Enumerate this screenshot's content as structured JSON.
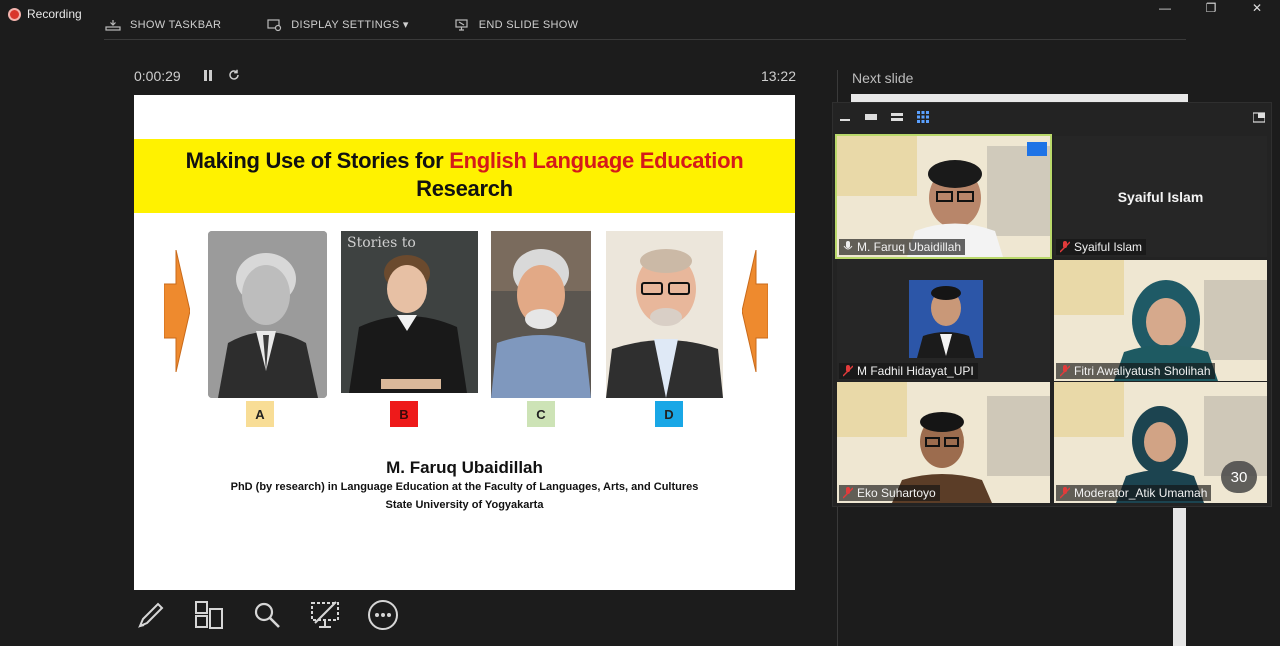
{
  "recording": {
    "label": "Recording"
  },
  "toolbar": {
    "show_taskbar": "SHOW TASKBAR",
    "display_settings": "DISPLAY SETTINGS ▾",
    "end_slide_show": "END SLIDE SHOW"
  },
  "timer": {
    "elapsed": "0:00:29",
    "clock": "13:22"
  },
  "slide": {
    "title_part1": "Making Use of Stories for ",
    "title_part2": "English Language Education",
    "title_line2": "Research",
    "chalk_text": "Stories to",
    "labels": [
      "A",
      "B",
      "C",
      "D"
    ],
    "label_colors": [
      "#f8dd96",
      "#ee1a1a",
      "#cde3b6",
      "#19a7e6"
    ],
    "presenter_name": "M. Faruq Ubaidillah",
    "presenter_line1": "PhD (by research) in Language Education at the Faculty of Languages, Arts, and Cultures",
    "presenter_line2": "State University of Yogyakarta"
  },
  "tools": [
    "pen-icon",
    "see-all-slides-icon",
    "zoom-icon",
    "black-screen-icon",
    "more-options-icon"
  ],
  "next_slide": {
    "label": "Next slide"
  },
  "call": {
    "participants": [
      {
        "name": "M. Faruq Ubaidillah",
        "muted": false,
        "video": true
      },
      {
        "name": "Syaiful Islam",
        "muted": true,
        "video": false,
        "display_name": "Syaiful Islam"
      },
      {
        "name": "M Fadhil Hidayat_UPI",
        "muted": true,
        "video": true
      },
      {
        "name": "Fitri Awaliyatush Sholihah",
        "muted": true,
        "video": true
      },
      {
        "name": "Eko Suhartoyo",
        "muted": true,
        "video": true
      },
      {
        "name": "Moderator_Atik Umamah",
        "muted": true,
        "video": true
      }
    ],
    "participant_count": "30"
  },
  "window_controls": {
    "minimize": "—",
    "restore": "❐",
    "close": "✕"
  }
}
